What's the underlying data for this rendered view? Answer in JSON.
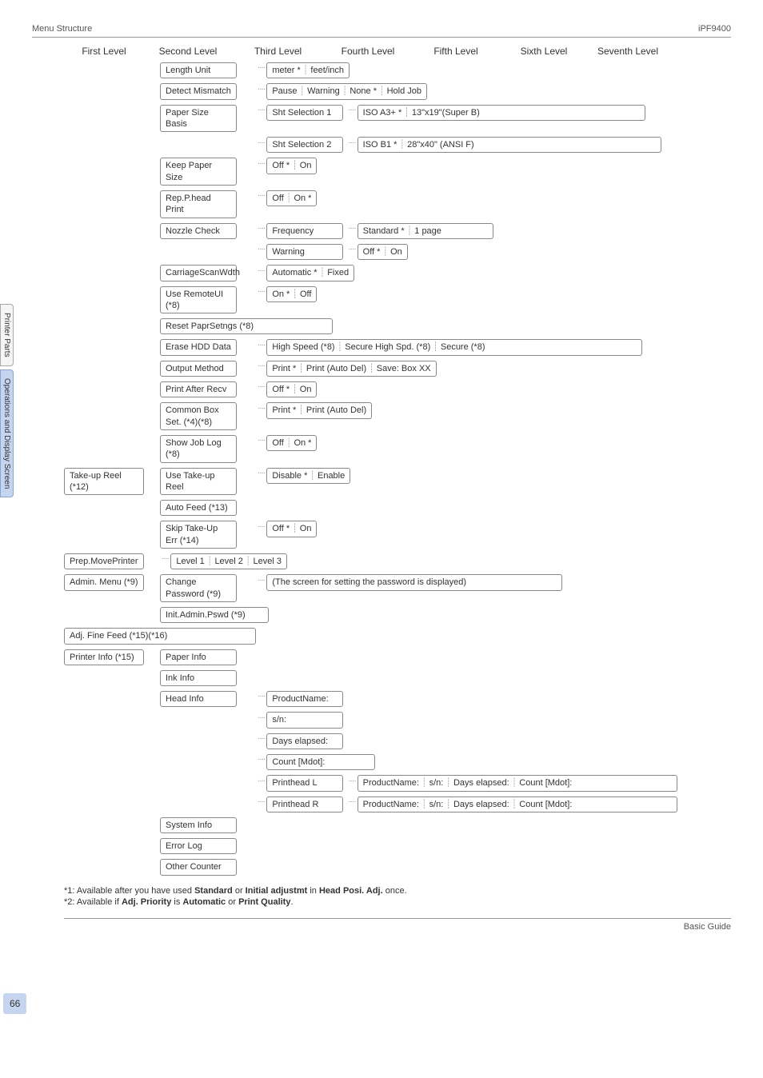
{
  "header": {
    "left": "Menu Structure",
    "right": "iPF9400"
  },
  "levels": [
    "First Level",
    "Second Level",
    "Third Level",
    "Fourth Level",
    "Fifth Level",
    "Sixth Level",
    "Seventh Level"
  ],
  "tabs": {
    "t1": "Printer Parts",
    "t2": "Operations and Display Screen"
  },
  "pagenum": "66",
  "s2": {
    "length_unit": "Length Unit",
    "length_unit_opts": [
      "meter *",
      "feet/inch"
    ],
    "detect_mismatch": "Detect Mismatch",
    "detect_mismatch_opts": [
      "Pause",
      "Warning",
      "None *",
      "Hold Job"
    ],
    "paper_size_basis": "Paper Size Basis",
    "sht_sel_1": "Sht Selection 1",
    "sht_sel_1_opts": [
      "ISO A3+ *",
      "13\"x19\"(Super B)"
    ],
    "sht_sel_2": "Sht Selection 2",
    "sht_sel_2_opts": [
      "ISO B1 *",
      "28\"x40\" (ANSI F)"
    ],
    "keep_paper_size": "Keep Paper Size",
    "keep_paper_size_opts": [
      "Off *",
      "On"
    ],
    "rep_phead": "Rep.P.head Print",
    "rep_phead_opts": [
      "Off",
      "On *"
    ],
    "nozzle_check": "Nozzle Check",
    "frequency": "Frequency",
    "frequency_opts": [
      "Standard *",
      "1 page"
    ],
    "warning": "Warning",
    "warning_opts": [
      "Off *",
      "On"
    ],
    "carriage_scan": "CarriageScanWdth",
    "carriage_scan_opts": [
      "Automatic *",
      "Fixed"
    ],
    "use_remote": "Use RemoteUI (*8)",
    "use_remote_opts": [
      "On *",
      "Off"
    ],
    "reset_papr": "Reset PaprSetngs (*8)",
    "erase_hdd": "Erase HDD Data",
    "erase_hdd_opts": [
      "High Speed (*8)",
      "Secure High Spd. (*8)",
      "Secure (*8)"
    ],
    "output_method": "Output Method",
    "output_method_opts": [
      "Print *",
      "Print (Auto Del)",
      "Save: Box XX"
    ],
    "print_after_recv": "Print After Recv",
    "print_after_recv_opts": [
      "Off *",
      "On"
    ],
    "common_box": "Common Box Set. (*4)(*8)",
    "common_box_opts": [
      "Print *",
      "Print (Auto Del)"
    ],
    "show_job_log": "Show Job Log (*8)",
    "show_job_log_opts": [
      "Off",
      "On *"
    ]
  },
  "takeup": {
    "label": "Take-up Reel (*12)",
    "use_takeup": "Use Take-up Reel",
    "use_takeup_opts": [
      "Disable *",
      "Enable"
    ],
    "auto_feed": "Auto Feed (*13)",
    "skip_takeup": "Skip Take-Up Err (*14)",
    "skip_takeup_opts": [
      "Off *",
      "On"
    ]
  },
  "prep": {
    "label": "Prep.MovePrinter",
    "opts": [
      "Level 1",
      "Level 2",
      "Level 3"
    ]
  },
  "admin": {
    "label": "Admin. Menu (*9)",
    "change_pass": "Change Password (*9)",
    "change_pass_screen": "(The screen for setting the password is displayed)",
    "init_admin": "Init.Admin.Pswd (*9)"
  },
  "adj_fine": "Adj. Fine Feed (*15)(*16)",
  "printer_info": {
    "label": "Printer Info (*15)",
    "paper_info": "Paper Info",
    "ink_info": "Ink Info",
    "head_info": "Head Info",
    "product_name": "ProductName:",
    "sn": "s/n:",
    "days_elapsed": "Days elapsed:",
    "count_mdot": "Count [Mdot]:",
    "printhead_l": "Printhead L",
    "printhead_l_opts": [
      "ProductName:",
      "s/n:",
      "Days elapsed:",
      "Count [Mdot]:"
    ],
    "printhead_r": "Printhead R",
    "printhead_r_opts": [
      "ProductName:",
      "s/n:",
      "Days elapsed:",
      "Count [Mdot]:"
    ],
    "system_info": "System Info",
    "error_log": "Error Log",
    "other_counter": "Other Counter"
  },
  "footnotes": {
    "f1_pre": "*1: Available after you have used ",
    "f1_b1": "Standard",
    "f1_mid1": " or ",
    "f1_b2": "Initial adjustmt",
    "f1_mid2": " in ",
    "f1_b3": "Head Posi. Adj.",
    "f1_post": " once.",
    "f2_pre": "*2: Available if ",
    "f2_b1": "Adj. Priority",
    "f2_mid1": " is ",
    "f2_b2": "Automatic",
    "f2_mid2": " or ",
    "f2_b3": "Print Quality",
    "f2_post": "."
  },
  "footer": "Basic Guide"
}
